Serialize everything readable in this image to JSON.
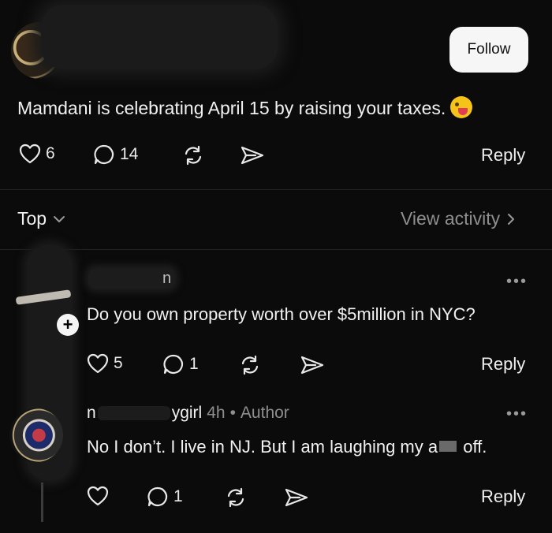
{
  "post": {
    "follow_label": "Follow",
    "text": "Mamdani is celebrating April 15 by raising your taxes.",
    "likes": "6",
    "comments": "14",
    "reply_label": "Reply"
  },
  "sort": {
    "label": "Top",
    "view_activity": "View activity"
  },
  "comments": [
    {
      "name_fragment": "n",
      "text": "Do you own property worth over $5million in NYC?",
      "likes": "5",
      "comments": "1",
      "reply_label": "Reply"
    },
    {
      "name_prefix": "n",
      "name_suffix": "ygirl",
      "time": "4h",
      "separator": "•",
      "badge": "Author",
      "text_before": "No I don’t. I live in NJ. But I am laughing my a",
      "text_after": "off.",
      "comments": "1",
      "reply_label": "Reply"
    }
  ],
  "icons": {
    "like": "heart-icon",
    "comment": "comment-bubble-icon",
    "repost": "repost-icon",
    "share": "send-icon",
    "chevron_down": "chevron-down-icon",
    "chevron_right": "chevron-right-icon",
    "more": "more-dots-icon",
    "add": "plus-icon"
  },
  "colors": {
    "background": "#0b0b0b",
    "text": "#f3f3f3",
    "muted": "#8e8e8e",
    "follow_bg": "#f6f6f6"
  }
}
